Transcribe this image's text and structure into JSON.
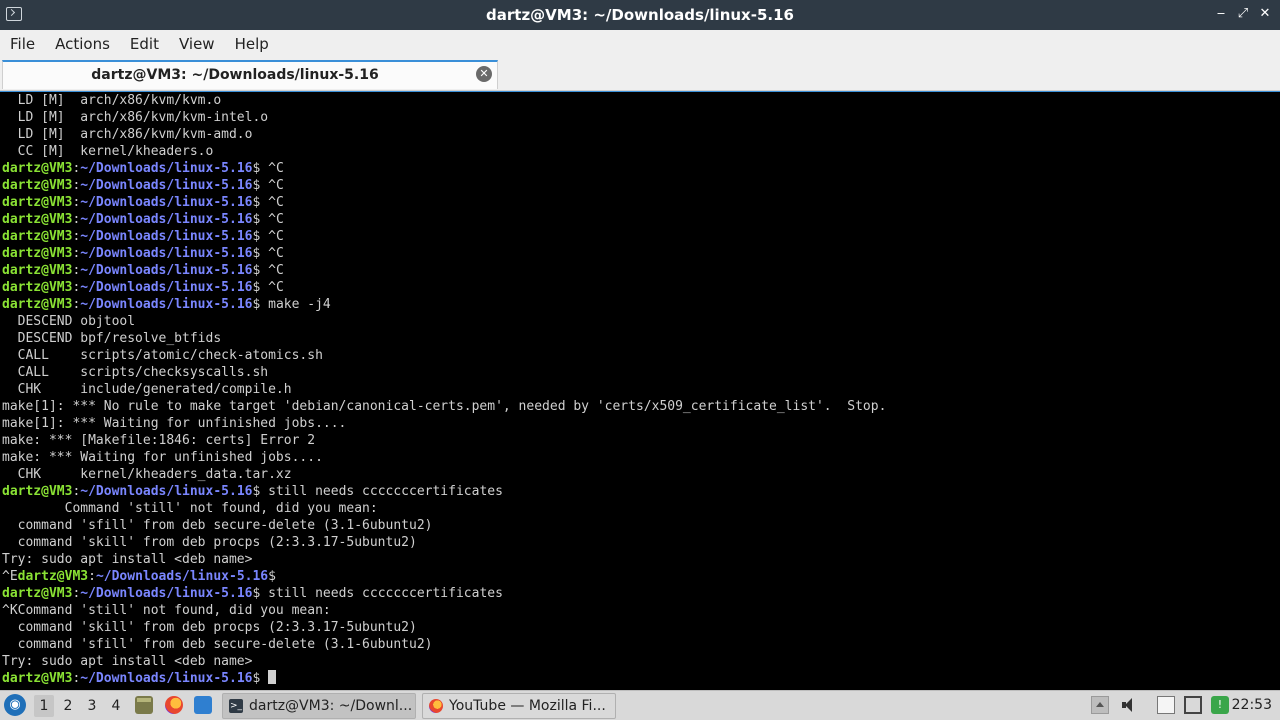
{
  "window": {
    "title": "dartz@VM3: ~/Downloads/linux-5.16",
    "icon": "terminal-icon",
    "controls": [
      "minimize",
      "maximize",
      "close"
    ]
  },
  "menu": {
    "file": "File",
    "actions": "Actions",
    "edit": "Edit",
    "view": "View",
    "help": "Help"
  },
  "tabs": {
    "active_label": "dartz@VM3: ~/Downloads/linux-5.16",
    "close_glyph": "✕"
  },
  "terminal": {
    "prompt_user": "dartz@VM3",
    "prompt_path": "~/Downloads/linux-5.16",
    "lines": [
      {
        "type": "out",
        "text": "  LD [M]  arch/x86/kvm/kvm.o"
      },
      {
        "type": "out",
        "text": "  LD [M]  arch/x86/kvm/kvm-intel.o"
      },
      {
        "type": "out",
        "text": "  LD [M]  arch/x86/kvm/kvm-amd.o"
      },
      {
        "type": "out",
        "text": "  CC [M]  kernel/kheaders.o"
      },
      {
        "type": "prompt",
        "cmd": " ^C"
      },
      {
        "type": "prompt",
        "cmd": " ^C"
      },
      {
        "type": "prompt",
        "cmd": " ^C"
      },
      {
        "type": "prompt",
        "cmd": " ^C"
      },
      {
        "type": "prompt",
        "cmd": " ^C"
      },
      {
        "type": "prompt",
        "cmd": " ^C"
      },
      {
        "type": "prompt",
        "cmd": " ^C"
      },
      {
        "type": "prompt",
        "cmd": " ^C"
      },
      {
        "type": "prompt",
        "cmd": " make -j4"
      },
      {
        "type": "out",
        "text": "  DESCEND objtool"
      },
      {
        "type": "out",
        "text": "  DESCEND bpf/resolve_btfids"
      },
      {
        "type": "out",
        "text": "  CALL    scripts/atomic/check-atomics.sh"
      },
      {
        "type": "out",
        "text": "  CALL    scripts/checksyscalls.sh"
      },
      {
        "type": "out",
        "text": "  CHK     include/generated/compile.h"
      },
      {
        "type": "out",
        "text": "make[1]: *** No rule to make target 'debian/canonical-certs.pem', needed by 'certs/x509_certificate_list'.  Stop."
      },
      {
        "type": "out",
        "text": "make[1]: *** Waiting for unfinished jobs...."
      },
      {
        "type": "out",
        "text": "make: *** [Makefile:1846: certs] Error 2"
      },
      {
        "type": "out",
        "text": "make: *** Waiting for unfinished jobs...."
      },
      {
        "type": "out",
        "text": "  CHK     kernel/kheaders_data.tar.xz"
      },
      {
        "type": "prompt",
        "cmd": " still needs cccccccertificates"
      },
      {
        "type": "out",
        "text": "        Command 'still' not found, did you mean:"
      },
      {
        "type": "out",
        "text": "  command 'sfill' from deb secure-delete (3.1-6ubuntu2)"
      },
      {
        "type": "out",
        "text": "  command 'skill' from deb procps (2:3.3.17-5ubuntu2)"
      },
      {
        "type": "out",
        "text": "Try: sudo apt install <deb name>"
      },
      {
        "type": "prompt",
        "prefix": "^E",
        "cmd": ""
      },
      {
        "type": "prompt",
        "cmd": " still needs cccccccertificates"
      },
      {
        "type": "out",
        "text": "^KCommand 'still' not found, did you mean:"
      },
      {
        "type": "out",
        "text": "  command 'skill' from deb procps (2:3.3.17-5ubuntu2)"
      },
      {
        "type": "out",
        "text": "  command 'sfill' from deb secure-delete (3.1-6ubuntu2)"
      },
      {
        "type": "out",
        "text": "Try: sudo apt install <deb name>"
      },
      {
        "type": "prompt",
        "cmd": " ",
        "cursor": true
      }
    ]
  },
  "taskbar": {
    "workspaces": [
      "1",
      "2",
      "3",
      "4"
    ],
    "active_workspace": "1",
    "quicklaunch": [
      "files-icon",
      "firefox-icon",
      "desktop-icon"
    ],
    "tasks": [
      {
        "label": "dartz@VM3: ~/Downl...",
        "icon": "terminal-icon",
        "active": true
      },
      {
        "label": "YouTube — Mozilla Fi...",
        "icon": "firefox-icon",
        "active": false
      }
    ],
    "tray": [
      "tray-up-icon",
      "volume-icon",
      "clipboard-icon",
      "network-icon",
      "update-icon"
    ],
    "clock": "22:53"
  },
  "colors": {
    "prompt_user": "#8ae234",
    "prompt_path": "#7a86ff",
    "terminal_bg": "#000000",
    "terminal_fg": "#d0d0d0",
    "titlebar_bg": "#2f3a45"
  }
}
